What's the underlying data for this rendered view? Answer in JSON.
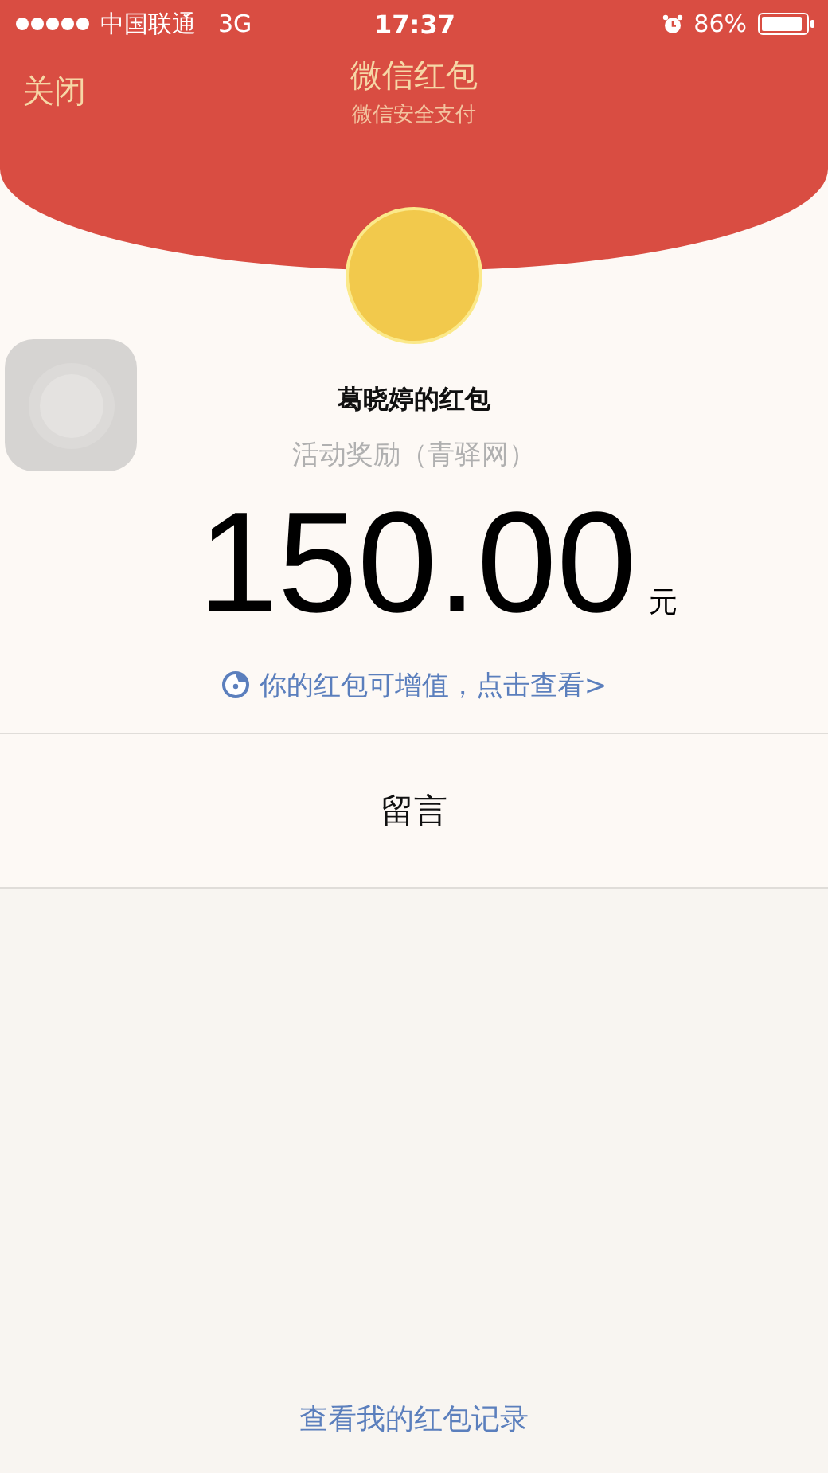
{
  "status_bar": {
    "carrier": "中国联通",
    "network": "3G",
    "time": "17:37",
    "battery": "86%"
  },
  "header": {
    "close": "关闭",
    "title": "微信红包",
    "subtitle": "微信安全支付"
  },
  "packet": {
    "sender": "葛晓婷的红包",
    "memo": "活动奖励（青驿网）",
    "amount": "150.00",
    "unit": "元",
    "link": "你的红包可增值，点击查看>"
  },
  "message": {
    "label": "留言"
  },
  "footer": {
    "link": "查看我的红包记录"
  }
}
